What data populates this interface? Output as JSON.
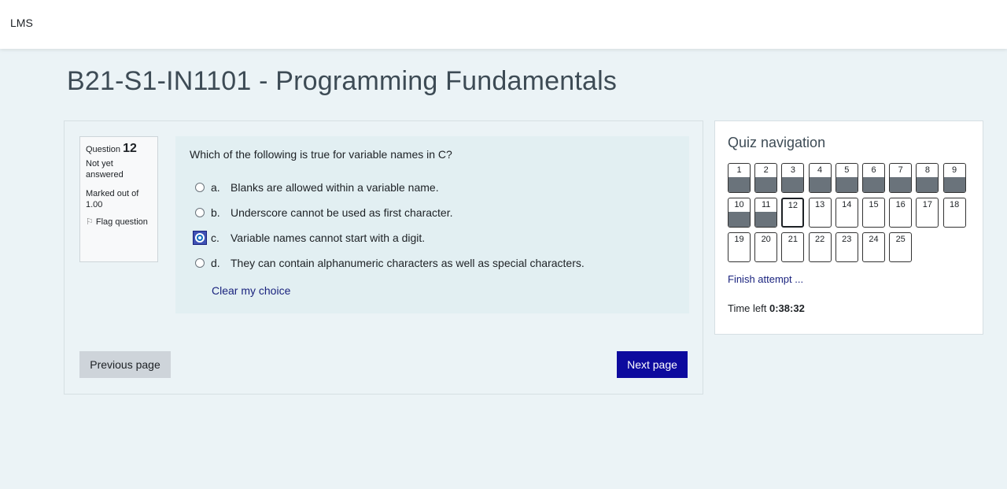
{
  "topbar": {
    "brand": "LMS"
  },
  "course": {
    "title": "B21-S1-IN1101 - Programming Fundamentals"
  },
  "question_info": {
    "label": "Question",
    "number": "12",
    "state": "Not yet answered",
    "grade": "Marked out of 1.00",
    "flag": "Flag question"
  },
  "question": {
    "text": "Which of the following is true for variable names in C?",
    "answers": [
      {
        "letter": "a.",
        "text": "Blanks are allowed within a variable name.",
        "selected": false
      },
      {
        "letter": "b.",
        "text": "Underscore cannot be used as first character.",
        "selected": false
      },
      {
        "letter": "c.",
        "text": "Variable names cannot start with a digit.",
        "selected": true
      },
      {
        "letter": "d.",
        "text": "They can contain alphanumeric characters as well as special characters.",
        "selected": false
      }
    ],
    "clear_choice": "Clear my choice"
  },
  "buttons": {
    "previous": "Previous page",
    "next": "Next page"
  },
  "quiz_nav": {
    "title": "Quiz navigation",
    "questions": [
      {
        "label": "1",
        "answered": true
      },
      {
        "label": "2",
        "answered": true
      },
      {
        "label": "3",
        "answered": true
      },
      {
        "label": "4",
        "answered": true
      },
      {
        "label": "5",
        "answered": true
      },
      {
        "label": "6",
        "answered": true
      },
      {
        "label": "7",
        "answered": true
      },
      {
        "label": "8",
        "answered": true
      },
      {
        "label": "9",
        "answered": true
      },
      {
        "label": "10",
        "answered": true
      },
      {
        "label": "11",
        "answered": true
      },
      {
        "label": "12",
        "answered": false,
        "current": true
      },
      {
        "label": "13",
        "answered": false
      },
      {
        "label": "14",
        "answered": false
      },
      {
        "label": "15",
        "answered": false
      },
      {
        "label": "16",
        "answered": false
      },
      {
        "label": "17",
        "answered": false
      },
      {
        "label": "18",
        "answered": false
      },
      {
        "label": "19",
        "answered": false
      },
      {
        "label": "20",
        "answered": false
      },
      {
        "label": "21",
        "answered": false
      },
      {
        "label": "22",
        "answered": false
      },
      {
        "label": "23",
        "answered": false
      },
      {
        "label": "24",
        "answered": false
      },
      {
        "label": "25",
        "answered": false
      }
    ],
    "finish": "Finish attempt ...",
    "time_left_label": "Time left",
    "time_left_value": "0:38:32"
  }
}
